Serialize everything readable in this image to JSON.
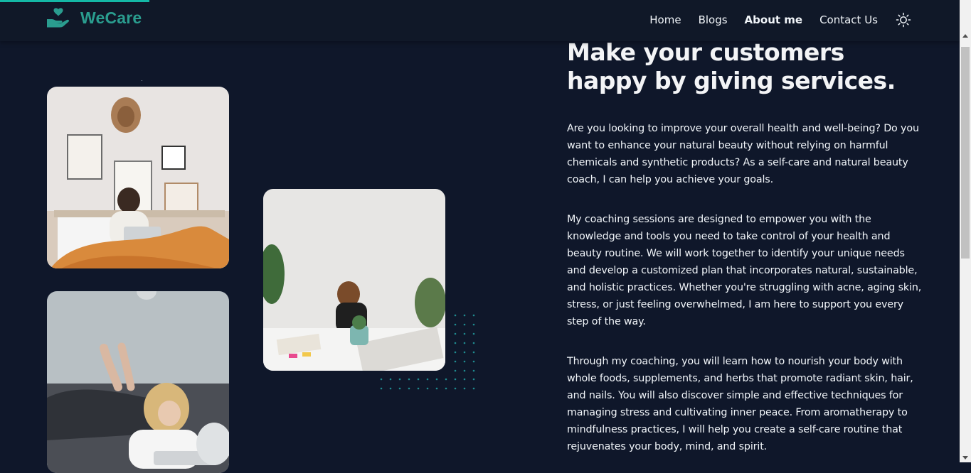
{
  "brand": {
    "name": "WeCare",
    "accent": "#2a9d8f"
  },
  "nav": {
    "links": [
      {
        "label": "Home"
      },
      {
        "label": "Blogs"
      },
      {
        "label": "About me",
        "active": true
      },
      {
        "label": "Contact Us"
      }
    ],
    "theme_icon": "sun-icon"
  },
  "about": {
    "headline": "Make your customers happy by giving services.",
    "paragraphs": [
      "Are you looking to improve your overall health and well-being? Do you want to enhance your natural beauty without relying on harmful chemicals and synthetic products? As a self-care and natural beauty coach, I can help you achieve your goals.",
      "My coaching sessions are designed to empower you with the knowledge and tools you need to take control of your health and beauty routine. We will work together to identify your unique needs and develop a customized plan that incorporates natural, sustainable, and holistic practices. Whether you're struggling with acne, aging skin, stress, or just feeling overwhelmed, I am here to support you every step of the way.",
      "Through my coaching, you will learn how to nourish your body with whole foods, supplements, and herbs that promote radiant skin, hair, and nails. You will also discover simple and effective techniques for managing stress and cultivating inner peace. From aromatherapy to mindfulness practices, I will help you create a self-care routine that rejuvenates your body, mind, and spirit."
    ]
  },
  "colors": {
    "background": "#0f172a",
    "navbar": "#101828",
    "accent": "#14b8a6",
    "text": "#f1f5f9"
  }
}
